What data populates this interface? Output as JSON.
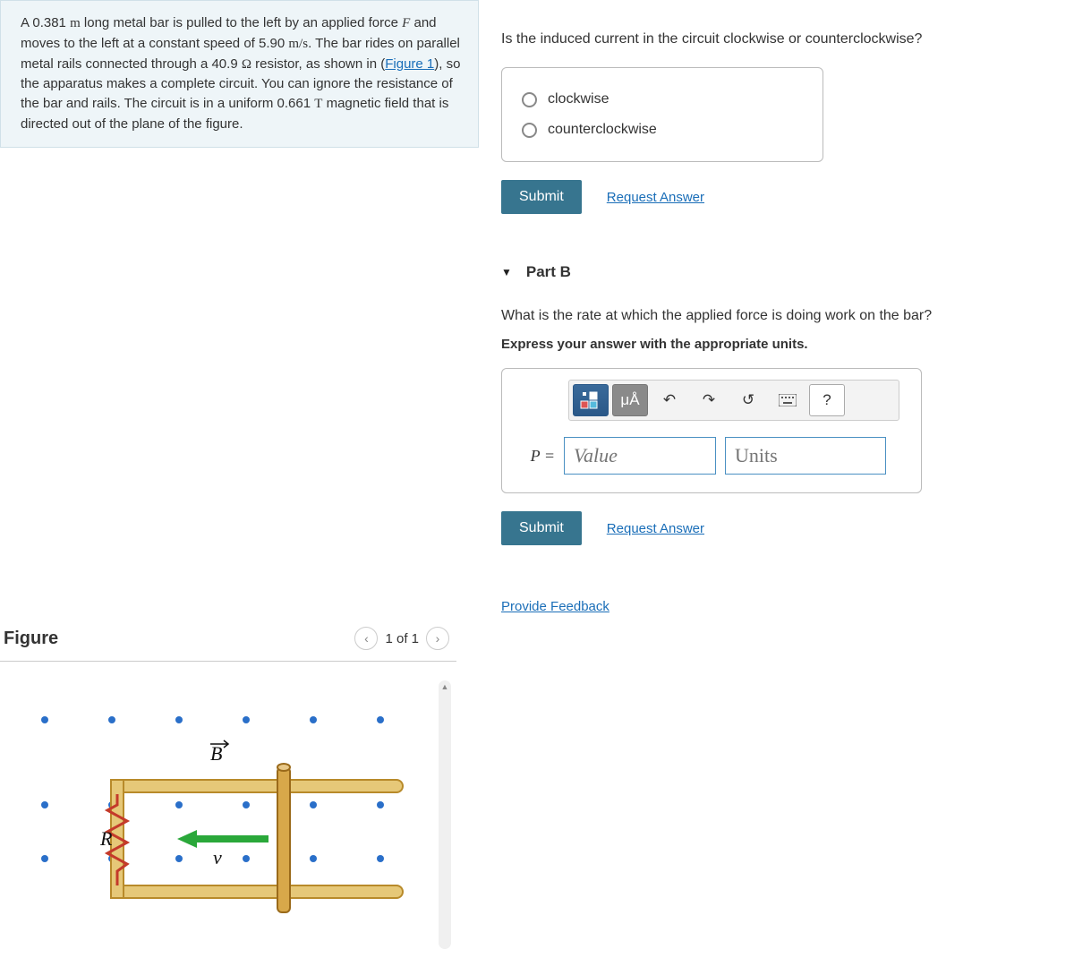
{
  "problem": {
    "length": "0.381",
    "length_unit": "m",
    "force_var": "F",
    "speed": "5.90",
    "speed_unit": "m/s",
    "resistance": "40.9",
    "resistance_unit": "Ω",
    "figure_link": "Figure 1",
    "mag_field": "0.661",
    "mag_field_unit": "T",
    "text_1": "A ",
    "text_2": " long metal bar is pulled to the left by an applied force ",
    "text_3": " and moves to the left at a constant speed of ",
    "text_4": ". The bar rides on parallel metal rails connected through a ",
    "text_5": " resistor, as shown in (",
    "text_6": "), so the apparatus makes a complete circuit. You can ignore the resistance of the bar and rails. The circuit is in a uniform ",
    "text_7": " magnetic field that is directed out of the plane of the figure."
  },
  "figure": {
    "title": "Figure",
    "pager": "1 of 1",
    "B_label": "B",
    "R_label": "R",
    "v_label": "v"
  },
  "partA": {
    "question": "Is the induced current in the circuit clockwise or counterclockwise?",
    "option1": "clockwise",
    "option2": "counterclockwise",
    "submit": "Submit",
    "request": "Request Answer"
  },
  "partB": {
    "header": "Part B",
    "question": "What is the rate at which the applied force is doing work on the bar?",
    "hint": "Express your answer with the appropriate units.",
    "toolbar": {
      "units": "μÅ",
      "help": "?"
    },
    "eq_label": "P =",
    "value_placeholder": "Value",
    "units_placeholder": "Units",
    "submit": "Submit",
    "request": "Request Answer"
  },
  "feedback": "Provide Feedback"
}
